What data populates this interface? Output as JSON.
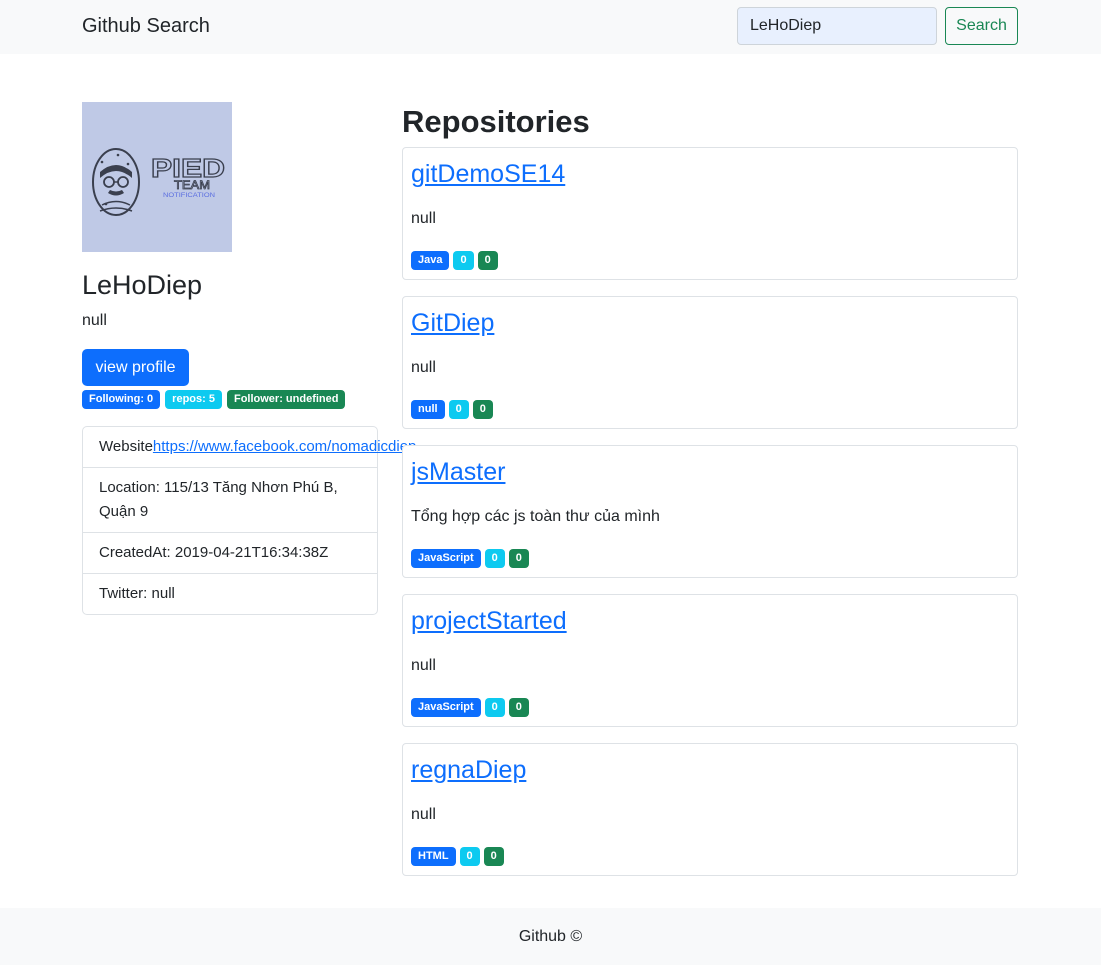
{
  "navbar": {
    "brand": "Github Search",
    "search_value": "LeHoDiep",
    "search_button": "Search"
  },
  "profile": {
    "avatar_text": "PIED TEAM",
    "avatar_subtext": "NOTIFICATION",
    "name": "LeHoDiep",
    "bio": "null",
    "view_button": "view profile",
    "stats": {
      "following": "Following: 0",
      "repos": "repos: 5",
      "followers": "Follower: undefined"
    },
    "info": {
      "website_label": "Website",
      "website_url": "https://www.facebook.com/nomadicdiep",
      "location": "Location: 115/13 Tăng Nhơn Phú B, Quận 9",
      "created_at": "CreatedAt: 2019-04-21T16:34:38Z",
      "twitter": "Twitter: null"
    }
  },
  "repositories": {
    "title": "Repositories",
    "items": [
      {
        "name": "gitDemoSE14",
        "description": "null",
        "language": "Java",
        "stars": "0",
        "forks": "0"
      },
      {
        "name": "GitDiep",
        "description": "null",
        "language": "null",
        "stars": "0",
        "forks": "0"
      },
      {
        "name": "jsMaster",
        "description": "Tổng hợp các js toàn thư của mình",
        "language": "JavaScript",
        "stars": "0",
        "forks": "0"
      },
      {
        "name": "projectStarted",
        "description": "null",
        "language": "JavaScript",
        "stars": "0",
        "forks": "0"
      },
      {
        "name": "regnaDiep",
        "description": "null",
        "language": "HTML",
        "stars": "0",
        "forks": "0"
      }
    ]
  },
  "footer": {
    "text": "Github ©"
  },
  "colors": {
    "primary": "#0d6efd",
    "info": "#0dcaf0",
    "success": "#198754",
    "navbar_bg": "#f8f9fa",
    "avatar_bg": "#bfc9e6"
  }
}
